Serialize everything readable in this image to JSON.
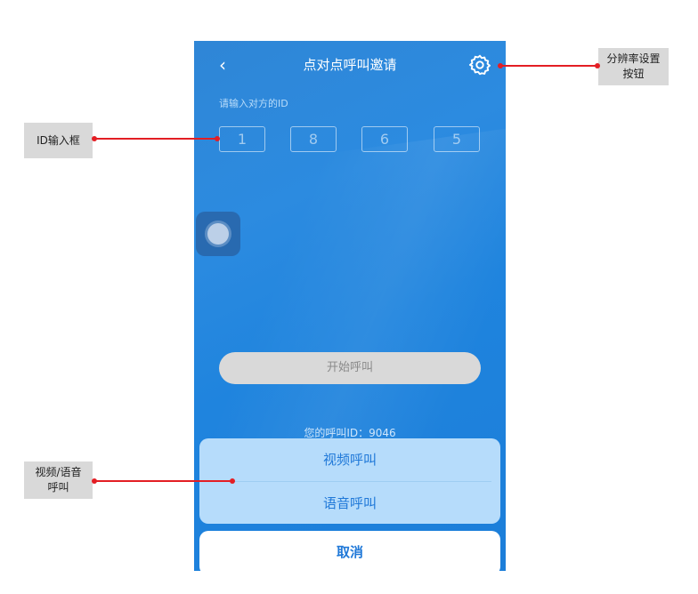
{
  "header": {
    "back_icon": "chevron-left-icon",
    "title": "点对点呼叫邀请",
    "settings_icon": "gear-icon"
  },
  "id_input": {
    "prompt": "请输入对方的ID",
    "digits": [
      "1",
      "8",
      "6",
      "5"
    ]
  },
  "start_call_label": "开始呼叫",
  "my_id_text": "您的呼叫ID：9046",
  "action_sheet": {
    "video_call": "视频呼叫",
    "voice_call": "语音呼叫",
    "cancel": "取消"
  },
  "annotations": {
    "resolution_settings": "分辨率设置\n按钮",
    "id_input_box": "ID输入框",
    "video_voice_call": "视频/语音\n呼叫"
  },
  "colors": {
    "background_blue": "#2c8be0",
    "sheet_bg": "#b6dcfb",
    "accent_text": "#1f78d8",
    "annotation_red": "#e31e24"
  }
}
